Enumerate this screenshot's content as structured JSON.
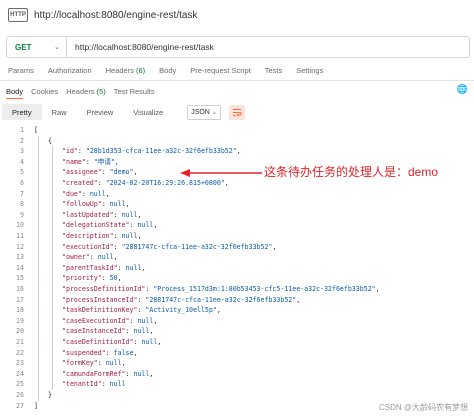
{
  "title_bar": {
    "http_badge": "HTTP",
    "url": "http://localhost:8080/engine-rest/task"
  },
  "request": {
    "method": "GET",
    "url": "http://localhost:8080/engine-rest/task"
  },
  "request_tabs": [
    {
      "label": "Params",
      "count": ""
    },
    {
      "label": "Authorization",
      "count": ""
    },
    {
      "label": "Headers",
      "count": "(6)"
    },
    {
      "label": "Body",
      "count": ""
    },
    {
      "label": "Pre-request Script",
      "count": ""
    },
    {
      "label": "Tests",
      "count": ""
    },
    {
      "label": "Settings",
      "count": ""
    }
  ],
  "response_tabs": [
    {
      "label": "Body",
      "count": "",
      "active": true
    },
    {
      "label": "Cookies",
      "count": "",
      "active": false
    },
    {
      "label": "Headers",
      "count": "(5)",
      "active": false
    },
    {
      "label": "Test Results",
      "count": "",
      "active": false
    }
  ],
  "view_modes": [
    "Pretty",
    "Raw",
    "Preview",
    "Visualize"
  ],
  "active_view": "Pretty",
  "format": "JSON",
  "code_lines": [
    {
      "n": "1",
      "key": "",
      "val": "",
      "vt": "",
      "text": "["
    },
    {
      "n": "2",
      "key": "",
      "val": "",
      "vt": "",
      "text": "{"
    },
    {
      "n": "3",
      "key": "\"id\"",
      "val": "\"28b1d353-cfca-11ee-a32c-32f6efb33b52\"",
      "vt": "s",
      "text": ""
    },
    {
      "n": "4",
      "key": "\"name\"",
      "val": "\"申请\"",
      "vt": "s",
      "text": ""
    },
    {
      "n": "5",
      "key": "\"assignee\"",
      "val": "\"demo\"",
      "vt": "s",
      "text": ""
    },
    {
      "n": "6",
      "key": "\"created\"",
      "val": "\"2024-02-20T16:29:26.815+0800\"",
      "vt": "s",
      "text": ""
    },
    {
      "n": "7",
      "key": "\"due\"",
      "val": "null",
      "vt": "lit",
      "text": ""
    },
    {
      "n": "8",
      "key": "\"followUp\"",
      "val": "null",
      "vt": "lit",
      "text": ""
    },
    {
      "n": "9",
      "key": "\"lastUpdated\"",
      "val": "null",
      "vt": "lit",
      "text": ""
    },
    {
      "n": "10",
      "key": "\"delegationState\"",
      "val": "null",
      "vt": "lit",
      "text": ""
    },
    {
      "n": "11",
      "key": "\"description\"",
      "val": "null",
      "vt": "lit",
      "text": ""
    },
    {
      "n": "12",
      "key": "\"executionId\"",
      "val": "\"2881747c-cfca-11ee-a32c-32f6efb33b52\"",
      "vt": "s",
      "text": ""
    },
    {
      "n": "13",
      "key": "\"owner\"",
      "val": "null",
      "vt": "lit",
      "text": ""
    },
    {
      "n": "14",
      "key": "\"parentTaskId\"",
      "val": "null",
      "vt": "lit",
      "text": ""
    },
    {
      "n": "15",
      "key": "\"priority\"",
      "val": "50",
      "vt": "lit",
      "text": ""
    },
    {
      "n": "16",
      "key": "\"processDefinitionId\"",
      "val": "\"Process_1517d3m:1:80b53453-cfc5-11ee-a32c-32f6efb33b52\"",
      "vt": "s",
      "text": ""
    },
    {
      "n": "17",
      "key": "\"processInstanceId\"",
      "val": "\"2881747c-cfca-11ee-a32c-32f6efb33b52\"",
      "vt": "s",
      "text": ""
    },
    {
      "n": "18",
      "key": "\"taskDefinitionKey\"",
      "val": "\"Activity_10ell5p\"",
      "vt": "s",
      "text": ""
    },
    {
      "n": "19",
      "key": "\"caseExecutionId\"",
      "val": "null",
      "vt": "lit",
      "text": ""
    },
    {
      "n": "20",
      "key": "\"caseInstanceId\"",
      "val": "null",
      "vt": "lit",
      "text": ""
    },
    {
      "n": "21",
      "key": "\"caseDefinitionId\"",
      "val": "null",
      "vt": "lit",
      "text": ""
    },
    {
      "n": "22",
      "key": "\"suspended\"",
      "val": "false",
      "vt": "lit",
      "text": ""
    },
    {
      "n": "23",
      "key": "\"formKey\"",
      "val": "null",
      "vt": "lit",
      "text": ""
    },
    {
      "n": "24",
      "key": "\"camundaFormRef\"",
      "val": "null",
      "vt": "lit",
      "text": ""
    },
    {
      "n": "25",
      "key": "\"tenantId\"",
      "val": "null",
      "vt": "lit",
      "text": ""
    },
    {
      "n": "26",
      "key": "",
      "val": "",
      "vt": "",
      "text": "}"
    },
    {
      "n": "27",
      "key": "",
      "val": "",
      "vt": "",
      "text": "]"
    }
  ],
  "annotation": "这条待办任务的处理人是：demo",
  "watermark": "CSDN @大龄码农有梦想",
  "colors": {
    "accent": "#ff6c37",
    "get_method": "#0f7b3a",
    "annotation": "#e3242b",
    "json_key": "#a11d48",
    "json_string": "#0b5cad"
  }
}
